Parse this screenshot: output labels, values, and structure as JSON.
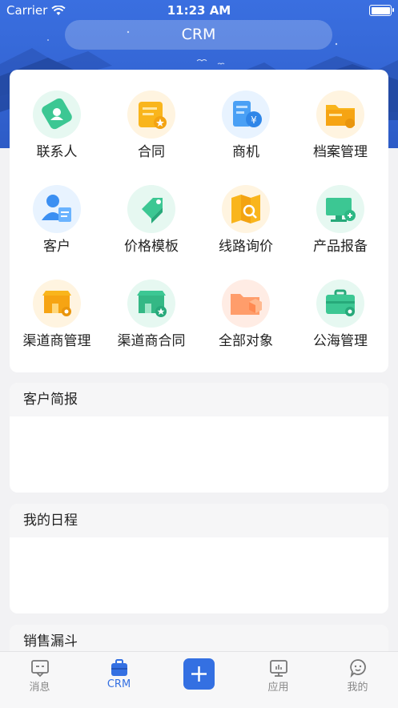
{
  "status": {
    "carrier": "Carrier",
    "time": "11:23 AM"
  },
  "header": {
    "title": "CRM"
  },
  "grid": [
    {
      "label": "联系人",
      "icon": "contact-icon"
    },
    {
      "label": "合同",
      "icon": "contract-icon"
    },
    {
      "label": "商机",
      "icon": "opportunity-icon"
    },
    {
      "label": "档案管理",
      "icon": "archive-icon"
    },
    {
      "label": "客户",
      "icon": "customer-icon"
    },
    {
      "label": "价格模板",
      "icon": "price-tag-icon"
    },
    {
      "label": "线路询价",
      "icon": "route-map-icon"
    },
    {
      "label": "产品报备",
      "icon": "product-report-icon"
    },
    {
      "label": "渠道商管理",
      "icon": "channel-store-icon"
    },
    {
      "label": "渠道商合同",
      "icon": "channel-contract-icon"
    },
    {
      "label": "全部对象",
      "icon": "folder-box-icon"
    },
    {
      "label": "公海管理",
      "icon": "briefcase-gear-icon"
    }
  ],
  "sections": {
    "customer_report": "客户简报",
    "my_schedule": "我的日程",
    "sales_funnel": "销售漏斗"
  },
  "tabs": [
    {
      "label": "消息",
      "icon": "message-icon"
    },
    {
      "label": "CRM",
      "icon": "crm-bag-icon"
    },
    {
      "label": "",
      "icon": "plus-icon"
    },
    {
      "label": "应用",
      "icon": "apps-monitor-icon"
    },
    {
      "label": "我的",
      "icon": "profile-icon"
    }
  ],
  "colors": {
    "accent": "#3470e2",
    "hero": "#3567d6",
    "tab_inactive": "#888888"
  }
}
